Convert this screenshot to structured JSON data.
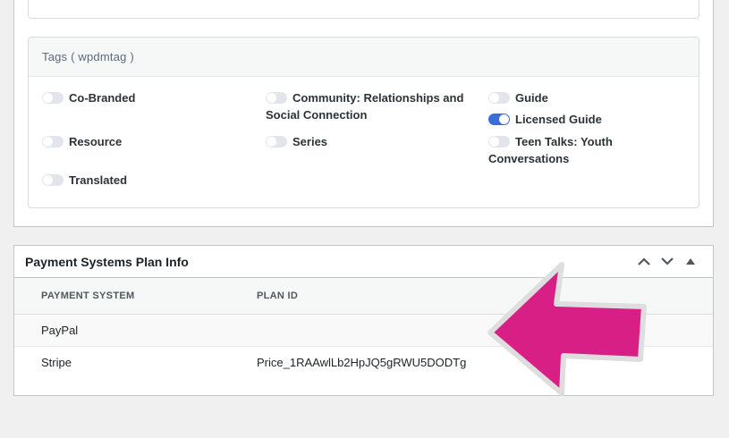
{
  "tags": {
    "header": "Tags ( wpdmtag )",
    "items": [
      {
        "label": "Co-Branded",
        "checked": false
      },
      {
        "label": "Community: Relationships and Social Connection",
        "checked": false
      },
      {
        "label": "Guide",
        "checked": false
      },
      {
        "label": "Licensed Guide",
        "checked": true
      },
      {
        "label": "Resource",
        "checked": false
      },
      {
        "label": "Series",
        "checked": false
      },
      {
        "label": "Teen Talks: Youth Conversations",
        "checked": false
      },
      {
        "label": "Translated",
        "checked": false
      }
    ]
  },
  "payment": {
    "title": "Payment Systems Plan Info",
    "columns": [
      "PAYMENT SYSTEM",
      "PLAN ID"
    ],
    "rows": [
      {
        "system": "PayPal",
        "plan_id": ""
      },
      {
        "system": "Stripe",
        "plan_id": "Price_1RAAwlLb2HpJQ5gRWU5DODTg"
      }
    ]
  },
  "colors": {
    "toggle_on": "#3b6dd6",
    "arrow": "#d81f85"
  }
}
